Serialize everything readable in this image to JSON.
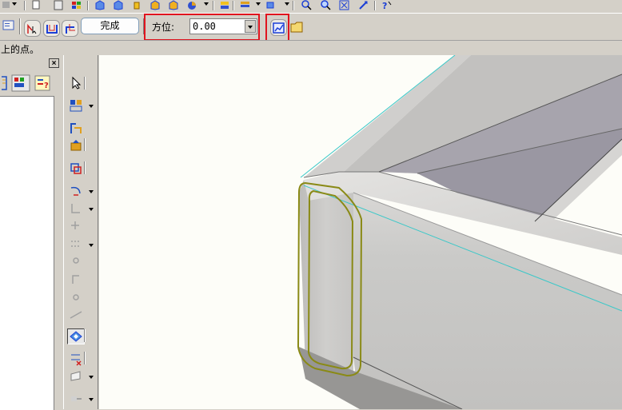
{
  "ribbon": {
    "finish_label": "完成",
    "orientation_label": "方位:",
    "orientation_value": "0.00"
  },
  "prompt": {
    "text": "上的点。"
  },
  "left_pane": {
    "close_label": "×"
  },
  "colors": {
    "highlight_box": "#e0141e",
    "selection_outline": "#8a8a16",
    "edge_line": "#38c8c8",
    "accent_blue": "#1b3fd6",
    "panel_face": "#d4d0c8",
    "model_face": "#c9c8c6",
    "channel_inner": "#9c98a4"
  },
  "icons": [
    "pointer-icon",
    "tool-group-icon",
    "sketch-icon",
    "fill-icon",
    "transform-icon",
    "arc-icon",
    "line-icon",
    "point-icon",
    "corner-icon",
    "circle-icon",
    "slash-icon",
    "plane-icon",
    "dimension-icon",
    "face-icon",
    "extend-icon"
  ]
}
